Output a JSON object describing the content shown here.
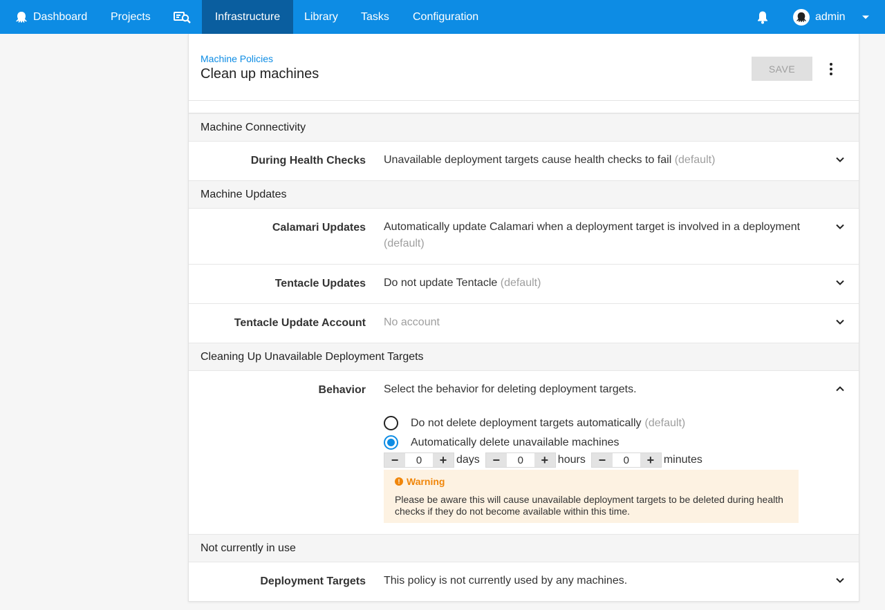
{
  "nav": {
    "items": [
      {
        "label": "Dashboard",
        "icon": "octopus-icon"
      },
      {
        "label": "Projects"
      },
      {
        "label": "",
        "icon": "search-machines-icon"
      },
      {
        "label": "Infrastructure",
        "active": true
      },
      {
        "label": "Library"
      },
      {
        "label": "Tasks"
      },
      {
        "label": "Configuration"
      }
    ],
    "user": "admin",
    "accent_color": "#0d8ce4",
    "active_color": "#0a5e9f"
  },
  "header": {
    "breadcrumb": "Machine Policies",
    "title": "Clean up machines",
    "save_label": "SAVE"
  },
  "sections": {
    "connectivity": {
      "title": "Machine Connectivity",
      "rows": [
        {
          "label": "During Health Checks",
          "value": "Unavailable deployment targets cause health checks to fail",
          "note": "(default)"
        }
      ]
    },
    "updates": {
      "title": "Machine Updates",
      "rows": [
        {
          "label": "Calamari Updates",
          "value": "Automatically update Calamari when a deployment target is involved in a deployment",
          "note": "(default)"
        },
        {
          "label": "Tentacle Updates",
          "value": "Do not update Tentacle",
          "note": "(default)"
        },
        {
          "label": "Tentacle Update Account",
          "value": "No account"
        }
      ]
    },
    "cleanup": {
      "title": "Cleaning Up Unavailable Deployment Targets",
      "behavior": {
        "label": "Behavior",
        "description": "Select the behavior for deleting deployment targets.",
        "options": [
          {
            "label": "Do not delete deployment targets automatically",
            "note": "(default)",
            "checked": false
          },
          {
            "label": "Automatically delete unavailable machines",
            "checked": true
          }
        ],
        "durations": [
          {
            "value": "0",
            "unit": "days"
          },
          {
            "value": "0",
            "unit": "hours"
          },
          {
            "value": "0",
            "unit": "minutes"
          }
        ],
        "warning_title": "Warning",
        "warning_text": "Please be aware this will cause unavailable deployment targets to be deleted during health checks if they do not become available within this time."
      }
    },
    "usage": {
      "title": "Not currently in use",
      "rows": [
        {
          "label": "Deployment Targets",
          "value": "This policy is not currently used by any machines."
        }
      ]
    }
  }
}
